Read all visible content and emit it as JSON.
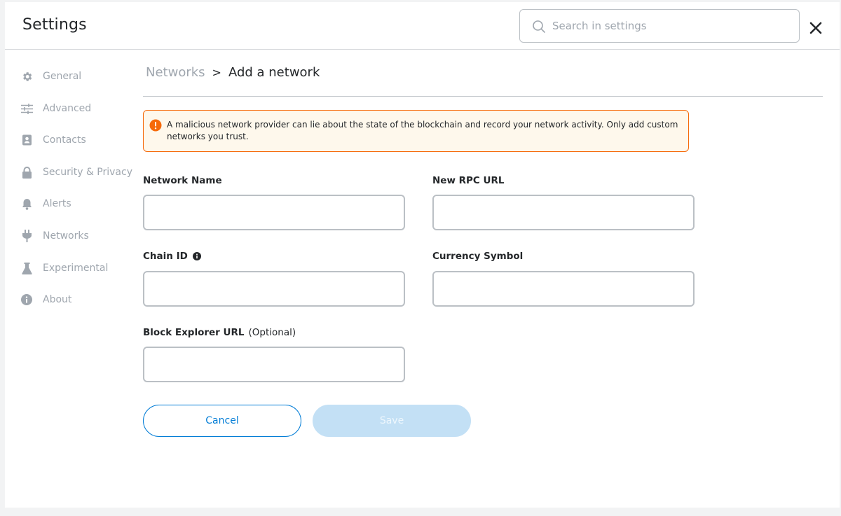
{
  "header": {
    "title": "Settings",
    "search_placeholder": "Search in settings"
  },
  "sidebar": {
    "items": [
      {
        "label": "General",
        "icon": "gear-icon"
      },
      {
        "label": "Advanced",
        "icon": "sliders-icon"
      },
      {
        "label": "Contacts",
        "icon": "contact-book-icon"
      },
      {
        "label": "Security & Privacy",
        "icon": "lock-icon"
      },
      {
        "label": "Alerts",
        "icon": "bell-icon"
      },
      {
        "label": "Networks",
        "icon": "plug-icon"
      },
      {
        "label": "Experimental",
        "icon": "flask-icon"
      },
      {
        "label": "About",
        "icon": "info-icon"
      }
    ]
  },
  "breadcrumb": {
    "parent": "Networks",
    "separator": ">",
    "current": "Add a network"
  },
  "warning": {
    "text": "A malicious network provider can lie about the state of the blockchain and record your network activity. Only add custom networks you trust."
  },
  "form": {
    "network_name_label": "Network Name",
    "rpc_url_label": "New RPC URL",
    "chain_id_label": "Chain ID",
    "currency_symbol_label": "Currency Symbol",
    "block_explorer_label": "Block Explorer URL",
    "block_explorer_optional": "(Optional)",
    "network_name_value": "",
    "rpc_url_value": "",
    "chain_id_value": "",
    "currency_symbol_value": "",
    "block_explorer_value": ""
  },
  "buttons": {
    "cancel": "Cancel",
    "save": "Save"
  },
  "colors": {
    "accent": "#037dd6",
    "warning_border": "#f66a0a",
    "warning_bg": "#fef8ec",
    "disabled_button": "#c3e0f5"
  }
}
